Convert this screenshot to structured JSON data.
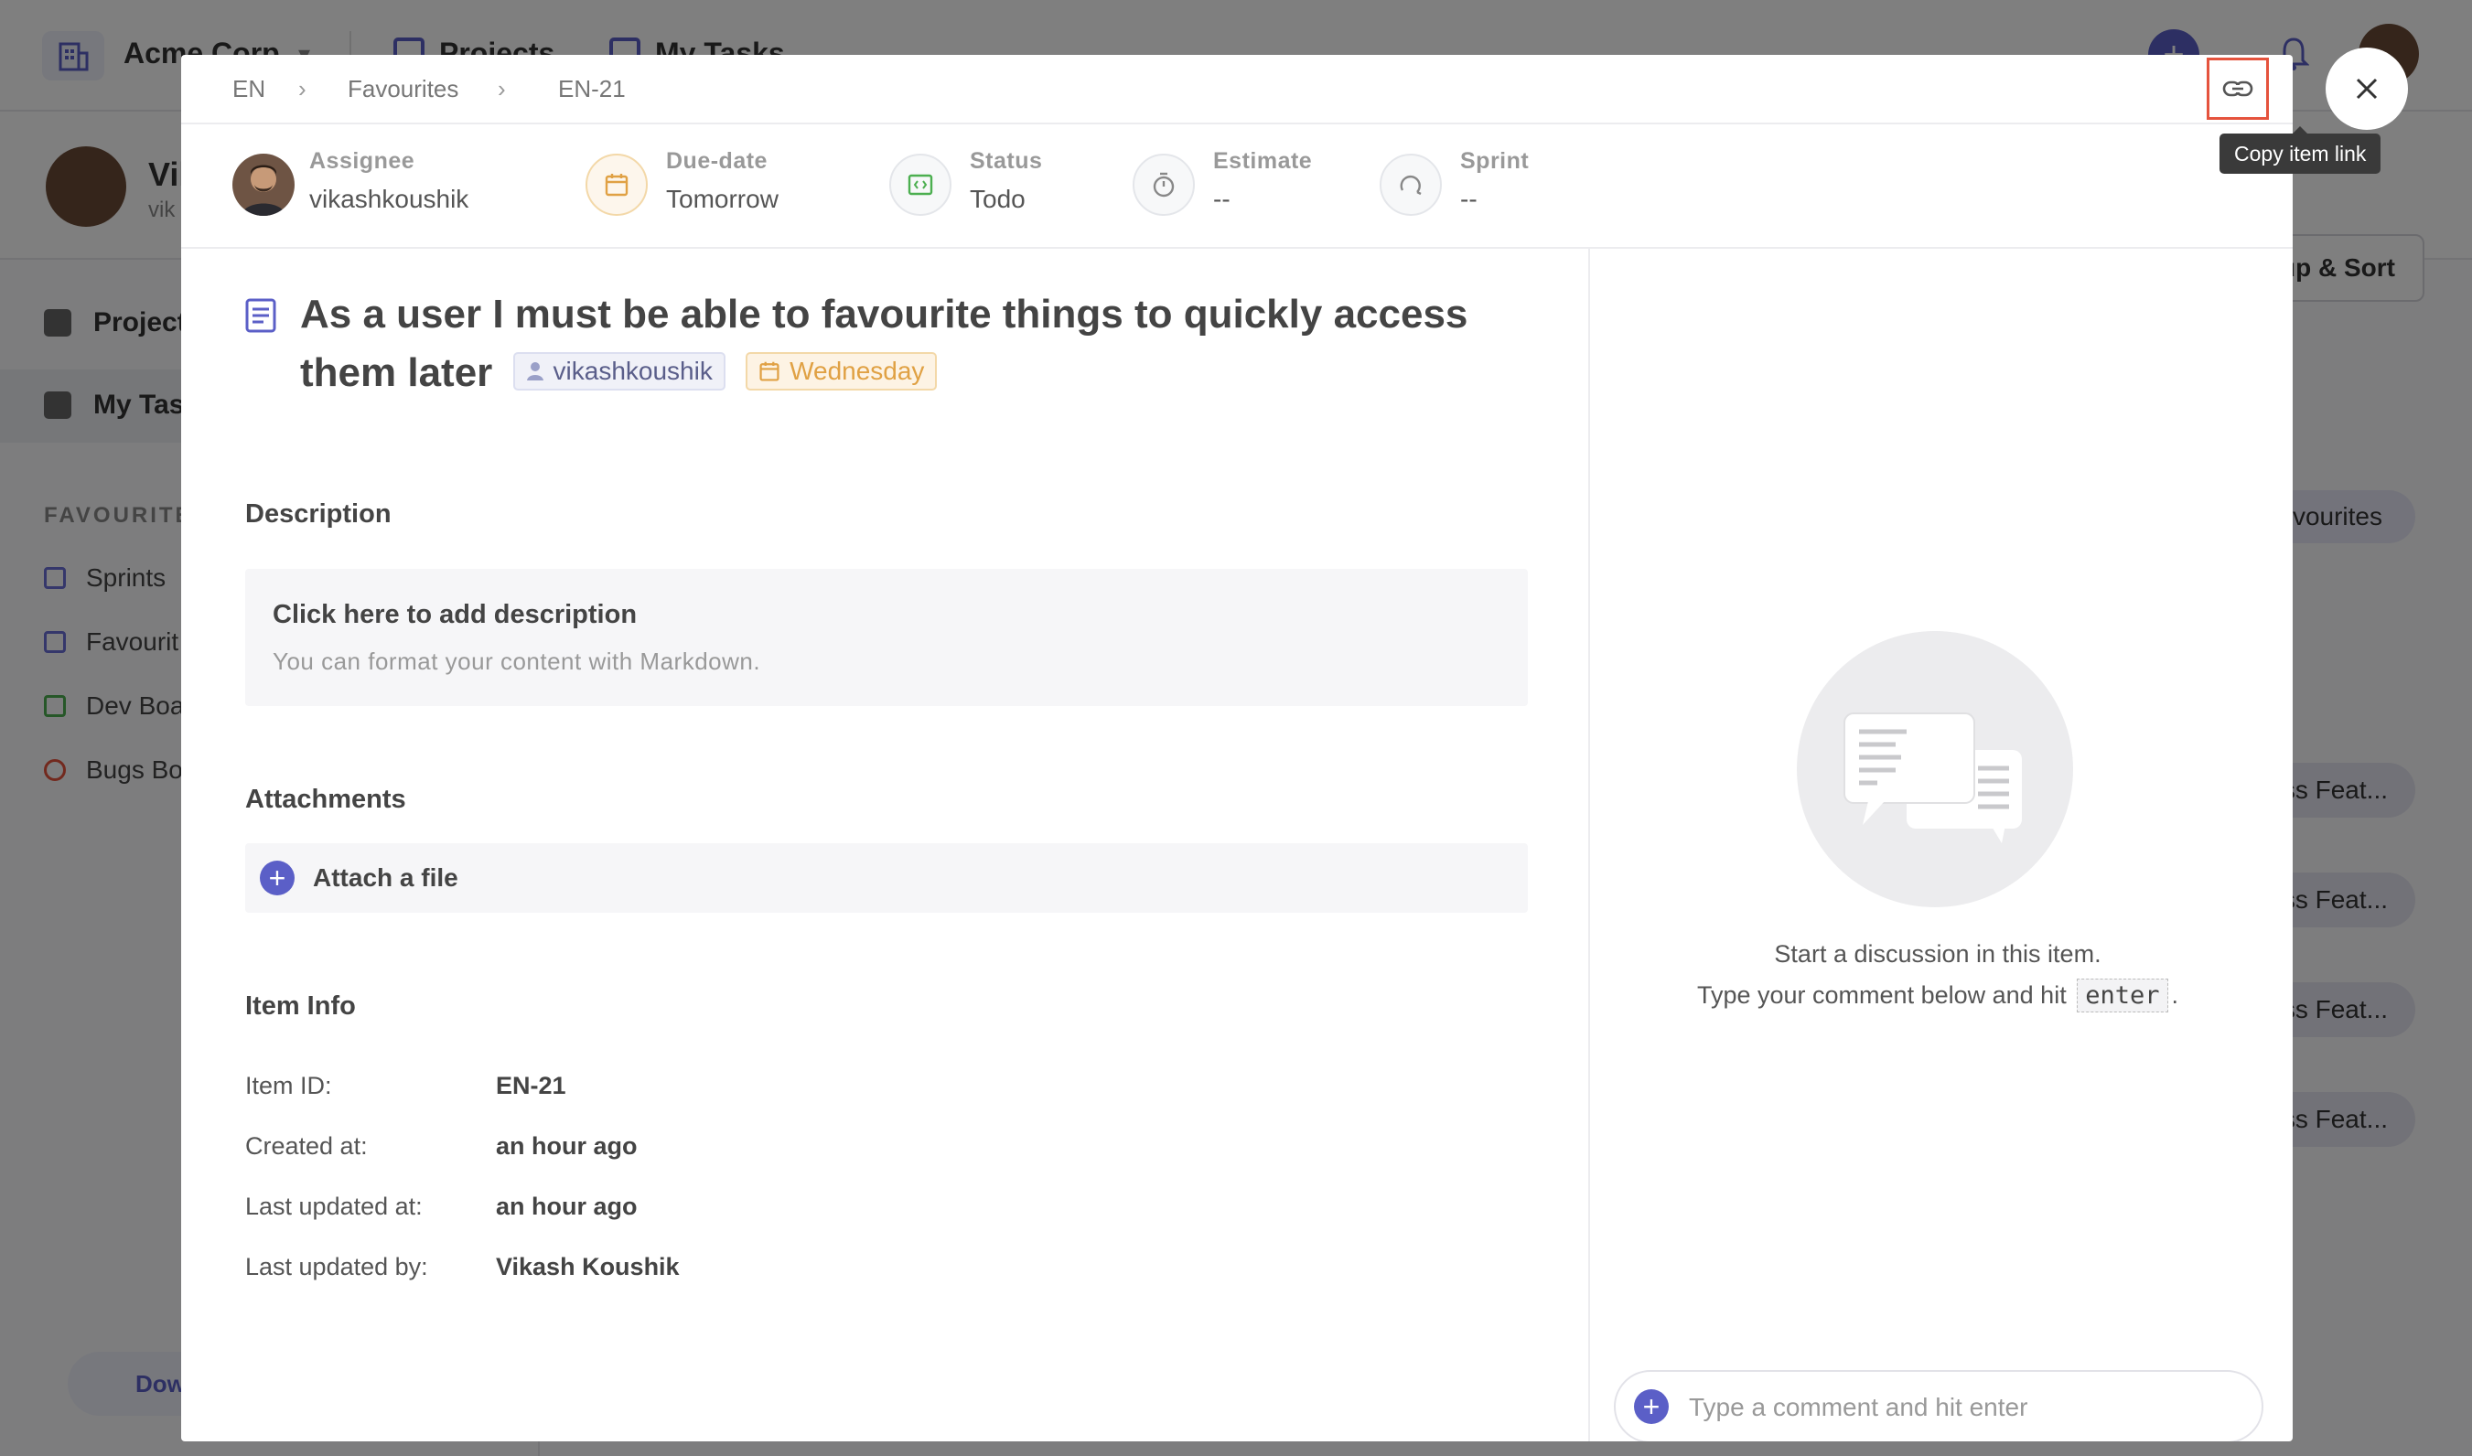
{
  "background": {
    "org_name": "Acme Corp",
    "nav_projects": "Projects",
    "nav_my_tasks": "My Tasks",
    "profile_name": "Vik",
    "profile_sub": "vik",
    "side_projects": "Project",
    "side_my_tasks": "My Tas",
    "favourites_head": "FAVOURITES",
    "fav_items": [
      "Sprints",
      "Favourit",
      "Dev Boa",
      "Bugs Bo"
    ],
    "download": "Dow",
    "group_sort": "oup & Sort",
    "favourites_pill": "avourites",
    "rows": [
      "oss Feat...",
      "oss Feat...",
      "oss Feat...",
      "oss Feat..."
    ]
  },
  "breadcrumb": [
    "EN",
    "Favourites",
    "EN-21"
  ],
  "meta": {
    "assignee": {
      "label": "Assignee",
      "value": "vikashkoushik"
    },
    "due_date": {
      "label": "Due-date",
      "value": "Tomorrow"
    },
    "status": {
      "label": "Status",
      "value": "Todo"
    },
    "estimate": {
      "label": "Estimate",
      "value": "--"
    },
    "sprint": {
      "label": "Sprint",
      "value": "--"
    }
  },
  "item": {
    "title": "As a user I must be able to favourite things to quickly access them later",
    "chip_user": "vikashkoushik",
    "chip_date": "Wednesday"
  },
  "description": {
    "heading": "Description",
    "title": "Click here to add description",
    "hint": "You can format your content with Markdown."
  },
  "attachments": {
    "heading": "Attachments",
    "action": "Attach a file"
  },
  "item_info": {
    "heading": "Item Info",
    "rows": [
      {
        "label": "Item ID:",
        "value": "EN-21"
      },
      {
        "label": "Created at:",
        "value": "an hour ago"
      },
      {
        "label": "Last updated at:",
        "value": "an hour ago"
      },
      {
        "label": "Last updated by:",
        "value": "Vikash Koushik"
      }
    ]
  },
  "discussion": {
    "line1": "Start a discussion in this item.",
    "line2_pre": "Type your comment below and hit",
    "key": "enter",
    "line2_post": ".",
    "placeholder": "Type a comment and hit enter"
  },
  "tooltip": "Copy item link",
  "colors": {
    "accent": "#5b5fc7",
    "due_orange": "#e0a144",
    "status_green": "#4caf50",
    "highlight_red": "#e5533d"
  }
}
